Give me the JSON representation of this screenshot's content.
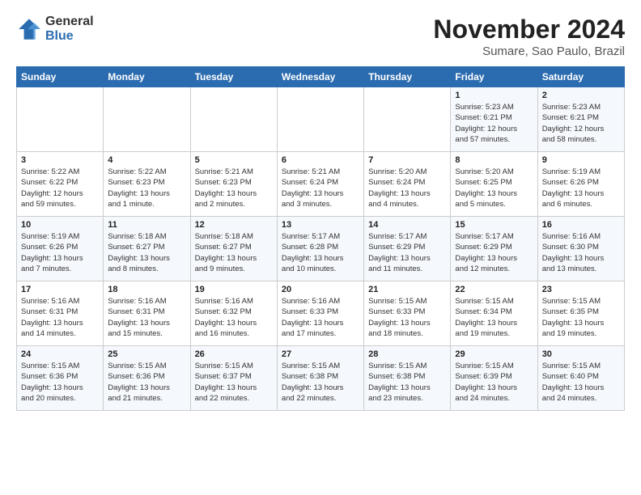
{
  "logo": {
    "general": "General",
    "blue": "Blue"
  },
  "title": "November 2024",
  "subtitle": "Sumare, Sao Paulo, Brazil",
  "headers": [
    "Sunday",
    "Monday",
    "Tuesday",
    "Wednesday",
    "Thursday",
    "Friday",
    "Saturday"
  ],
  "weeks": [
    [
      {
        "day": "",
        "info": ""
      },
      {
        "day": "",
        "info": ""
      },
      {
        "day": "",
        "info": ""
      },
      {
        "day": "",
        "info": ""
      },
      {
        "day": "",
        "info": ""
      },
      {
        "day": "1",
        "info": "Sunrise: 5:23 AM\nSunset: 6:21 PM\nDaylight: 12 hours\nand 57 minutes."
      },
      {
        "day": "2",
        "info": "Sunrise: 5:23 AM\nSunset: 6:21 PM\nDaylight: 12 hours\nand 58 minutes."
      }
    ],
    [
      {
        "day": "3",
        "info": "Sunrise: 5:22 AM\nSunset: 6:22 PM\nDaylight: 12 hours\nand 59 minutes."
      },
      {
        "day": "4",
        "info": "Sunrise: 5:22 AM\nSunset: 6:23 PM\nDaylight: 13 hours\nand 1 minute."
      },
      {
        "day": "5",
        "info": "Sunrise: 5:21 AM\nSunset: 6:23 PM\nDaylight: 13 hours\nand 2 minutes."
      },
      {
        "day": "6",
        "info": "Sunrise: 5:21 AM\nSunset: 6:24 PM\nDaylight: 13 hours\nand 3 minutes."
      },
      {
        "day": "7",
        "info": "Sunrise: 5:20 AM\nSunset: 6:24 PM\nDaylight: 13 hours\nand 4 minutes."
      },
      {
        "day": "8",
        "info": "Sunrise: 5:20 AM\nSunset: 6:25 PM\nDaylight: 13 hours\nand 5 minutes."
      },
      {
        "day": "9",
        "info": "Sunrise: 5:19 AM\nSunset: 6:26 PM\nDaylight: 13 hours\nand 6 minutes."
      }
    ],
    [
      {
        "day": "10",
        "info": "Sunrise: 5:19 AM\nSunset: 6:26 PM\nDaylight: 13 hours\nand 7 minutes."
      },
      {
        "day": "11",
        "info": "Sunrise: 5:18 AM\nSunset: 6:27 PM\nDaylight: 13 hours\nand 8 minutes."
      },
      {
        "day": "12",
        "info": "Sunrise: 5:18 AM\nSunset: 6:27 PM\nDaylight: 13 hours\nand 9 minutes."
      },
      {
        "day": "13",
        "info": "Sunrise: 5:17 AM\nSunset: 6:28 PM\nDaylight: 13 hours\nand 10 minutes."
      },
      {
        "day": "14",
        "info": "Sunrise: 5:17 AM\nSunset: 6:29 PM\nDaylight: 13 hours\nand 11 minutes."
      },
      {
        "day": "15",
        "info": "Sunrise: 5:17 AM\nSunset: 6:29 PM\nDaylight: 13 hours\nand 12 minutes."
      },
      {
        "day": "16",
        "info": "Sunrise: 5:16 AM\nSunset: 6:30 PM\nDaylight: 13 hours\nand 13 minutes."
      }
    ],
    [
      {
        "day": "17",
        "info": "Sunrise: 5:16 AM\nSunset: 6:31 PM\nDaylight: 13 hours\nand 14 minutes."
      },
      {
        "day": "18",
        "info": "Sunrise: 5:16 AM\nSunset: 6:31 PM\nDaylight: 13 hours\nand 15 minutes."
      },
      {
        "day": "19",
        "info": "Sunrise: 5:16 AM\nSunset: 6:32 PM\nDaylight: 13 hours\nand 16 minutes."
      },
      {
        "day": "20",
        "info": "Sunrise: 5:16 AM\nSunset: 6:33 PM\nDaylight: 13 hours\nand 17 minutes."
      },
      {
        "day": "21",
        "info": "Sunrise: 5:15 AM\nSunset: 6:33 PM\nDaylight: 13 hours\nand 18 minutes."
      },
      {
        "day": "22",
        "info": "Sunrise: 5:15 AM\nSunset: 6:34 PM\nDaylight: 13 hours\nand 19 minutes."
      },
      {
        "day": "23",
        "info": "Sunrise: 5:15 AM\nSunset: 6:35 PM\nDaylight: 13 hours\nand 19 minutes."
      }
    ],
    [
      {
        "day": "24",
        "info": "Sunrise: 5:15 AM\nSunset: 6:36 PM\nDaylight: 13 hours\nand 20 minutes."
      },
      {
        "day": "25",
        "info": "Sunrise: 5:15 AM\nSunset: 6:36 PM\nDaylight: 13 hours\nand 21 minutes."
      },
      {
        "day": "26",
        "info": "Sunrise: 5:15 AM\nSunset: 6:37 PM\nDaylight: 13 hours\nand 22 minutes."
      },
      {
        "day": "27",
        "info": "Sunrise: 5:15 AM\nSunset: 6:38 PM\nDaylight: 13 hours\nand 22 minutes."
      },
      {
        "day": "28",
        "info": "Sunrise: 5:15 AM\nSunset: 6:38 PM\nDaylight: 13 hours\nand 23 minutes."
      },
      {
        "day": "29",
        "info": "Sunrise: 5:15 AM\nSunset: 6:39 PM\nDaylight: 13 hours\nand 24 minutes."
      },
      {
        "day": "30",
        "info": "Sunrise: 5:15 AM\nSunset: 6:40 PM\nDaylight: 13 hours\nand 24 minutes."
      }
    ]
  ]
}
